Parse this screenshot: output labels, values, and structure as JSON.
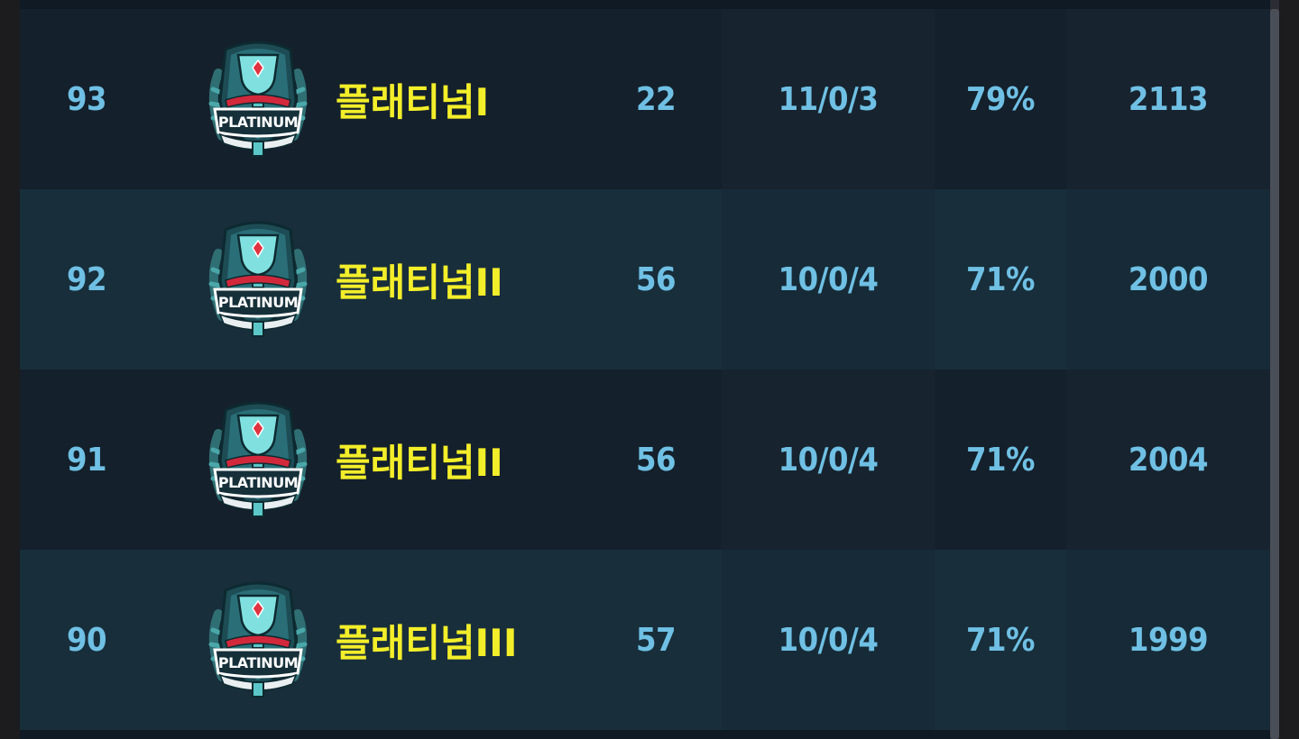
{
  "leaderboard": {
    "rows": [
      {
        "rank": "93",
        "tier": "플래티넘I",
        "badge_text": "PLATINUM",
        "games": "22",
        "record": "11/0/3",
        "winrate": "79%",
        "score": "2113"
      },
      {
        "rank": "92",
        "tier": "플래티넘II",
        "badge_text": "PLATINUM",
        "games": "56",
        "record": "10/0/4",
        "winrate": "71%",
        "score": "2000"
      },
      {
        "rank": "91",
        "tier": "플래티넘II",
        "badge_text": "PLATINUM",
        "games": "56",
        "record": "10/0/4",
        "winrate": "71%",
        "score": "2004"
      },
      {
        "rank": "90",
        "tier": "플래티넘III",
        "badge_text": "PLATINUM",
        "games": "57",
        "record": "10/0/4",
        "winrate": "71%",
        "score": "1999"
      }
    ]
  },
  "colors": {
    "row_dark": "#14202b",
    "row_light": "#182e3b",
    "value_text": "#6fc0e4",
    "tier_text": "#f3ee2a",
    "badge_teal": "#3fb4b8",
    "badge_red": "#d2283c"
  }
}
